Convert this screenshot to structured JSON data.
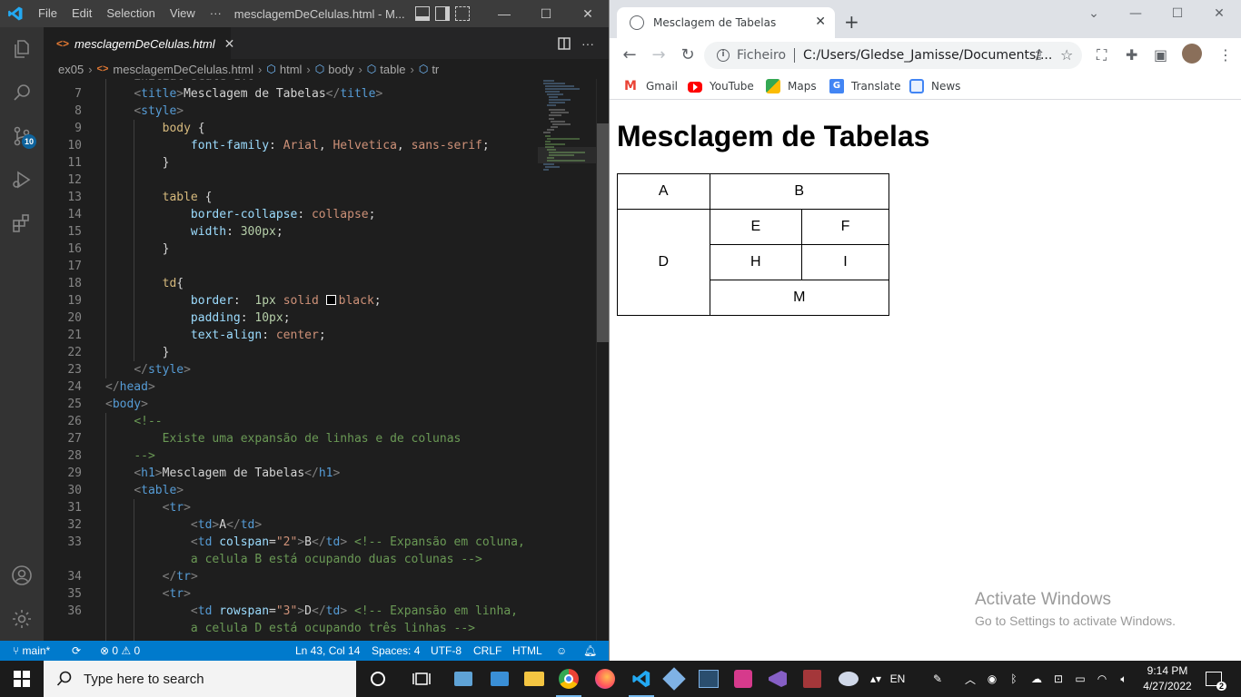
{
  "vscode": {
    "menu": [
      "File",
      "Edit",
      "Selection",
      "View",
      "···"
    ],
    "window_title": "mesclagemDeCelulas.html - M...",
    "tab": {
      "label": "mesclagemDeCelulas.html",
      "close": "✕"
    },
    "breadcrumb": [
      "ex05",
      "mesclagemDeCelulas.html",
      "html",
      "body",
      "table",
      "tr"
    ],
    "source_control_badge": "10",
    "code_lines": [
      {
        "n": "7"
      },
      {
        "n": "8"
      },
      {
        "n": "9"
      },
      {
        "n": "10"
      },
      {
        "n": "11"
      },
      {
        "n": "12"
      },
      {
        "n": "13"
      },
      {
        "n": "14"
      },
      {
        "n": "15"
      },
      {
        "n": "16"
      },
      {
        "n": "17"
      },
      {
        "n": "18"
      },
      {
        "n": "19"
      },
      {
        "n": "20"
      },
      {
        "n": "21"
      },
      {
        "n": "22"
      },
      {
        "n": "23"
      },
      {
        "n": "24"
      },
      {
        "n": "25"
      },
      {
        "n": "26"
      },
      {
        "n": "27"
      },
      {
        "n": "28"
      },
      {
        "n": "29"
      },
      {
        "n": "30"
      },
      {
        "n": "31"
      },
      {
        "n": "32"
      },
      {
        "n": "33"
      },
      {
        "n": ""
      },
      {
        "n": "34"
      },
      {
        "n": "35"
      },
      {
        "n": "36"
      },
      {
        "n": ""
      }
    ],
    "status": {
      "branch": "main*",
      "errors": "0",
      "warnings": "0",
      "position": "Ln 43, Col 14",
      "spaces": "Spaces: 4",
      "encoding": "UTF-8",
      "eol": "CRLF",
      "language": "HTML"
    }
  },
  "chrome": {
    "tab_title": "Mesclagem de Tabelas",
    "omnibox_label": "Ficheiro",
    "url": "C:/Users/Gledse_Jamisse/Documents/...",
    "bookmarks": [
      "Gmail",
      "YouTube",
      "Maps",
      "Translate",
      "News"
    ],
    "page": {
      "heading": "Mesclagem de Tabelas",
      "cells": {
        "a": "A",
        "b": "B",
        "d": "D",
        "e": "E",
        "f": "F",
        "h": "H",
        "i": "I",
        "m": "M"
      }
    },
    "activate": {
      "title": "Activate Windows",
      "subtitle": "Go to Settings to activate Windows."
    }
  },
  "taskbar": {
    "search_placeholder": "Type here to search",
    "language": "EN",
    "time": "9:14 PM",
    "date": "4/27/2022",
    "notifications": "2"
  },
  "colors": {
    "vscode_statusbar": "#007acc",
    "vscode_editor_bg": "#1e1e1e",
    "chrome_tabstrip": "#dee1e6",
    "accent_blue": "#0e639c"
  }
}
